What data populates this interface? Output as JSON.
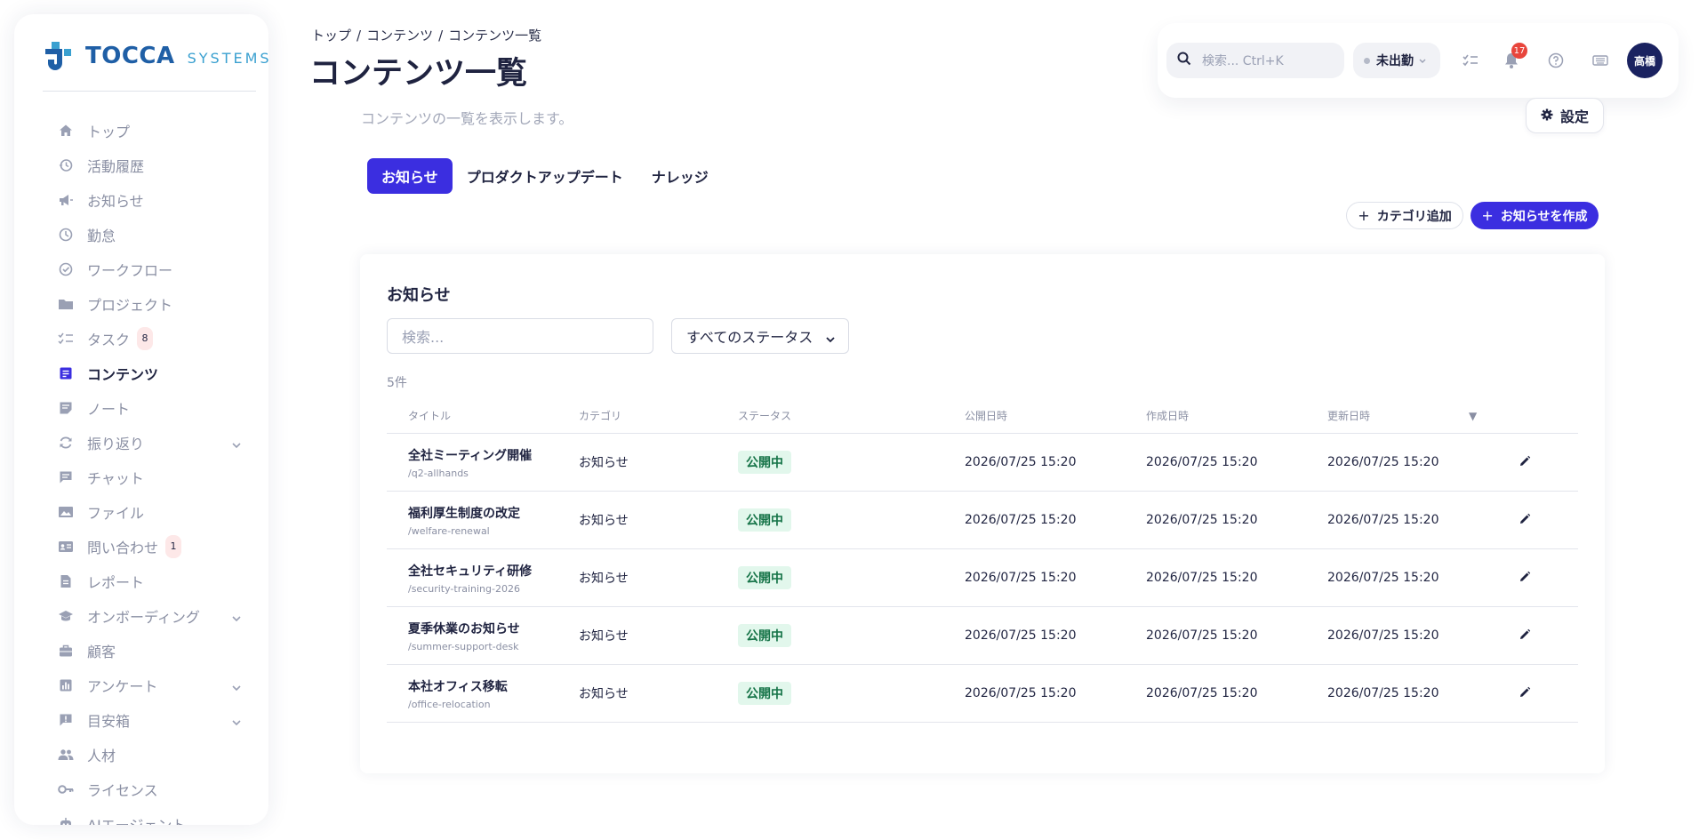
{
  "brand": {
    "name": "TOCCA",
    "sub": "SYSTEMS",
    "primary": "#3b2ee0"
  },
  "sidebar": {
    "items": [
      {
        "label": "トップ",
        "icon": "home-icon"
      },
      {
        "label": "活動履歴",
        "icon": "history-icon"
      },
      {
        "label": "お知らせ",
        "icon": "megaphone-icon"
      },
      {
        "label": "勤怠",
        "icon": "clock-icon"
      },
      {
        "label": "ワークフロー",
        "icon": "check-circle-icon"
      },
      {
        "label": "プロジェクト",
        "icon": "folder-icon"
      },
      {
        "label": "タスク",
        "icon": "checklist-icon",
        "badge": "8"
      },
      {
        "label": "コンテンツ",
        "icon": "document-icon",
        "active": true
      },
      {
        "label": "ノート",
        "icon": "note-icon"
      },
      {
        "label": "振り返り",
        "icon": "refresh-icon",
        "chevron": true
      },
      {
        "label": "チャット",
        "icon": "chat-icon"
      },
      {
        "label": "ファイル",
        "icon": "image-icon"
      },
      {
        "label": "問い合わせ",
        "icon": "id-card-icon",
        "badge": "1"
      },
      {
        "label": "レポート",
        "icon": "report-icon"
      },
      {
        "label": "オンボーディング",
        "icon": "graduation-icon",
        "chevron": true
      },
      {
        "label": "顧客",
        "icon": "briefcase-icon"
      },
      {
        "label": "アンケート",
        "icon": "bar-chart-icon",
        "chevron": true
      },
      {
        "label": "目安箱",
        "icon": "feedback-icon",
        "chevron": true
      },
      {
        "label": "人材",
        "icon": "people-icon"
      },
      {
        "label": "ライセンス",
        "icon": "key-icon"
      },
      {
        "label": "AIエージェント",
        "icon": "robot-icon"
      }
    ]
  },
  "header": {
    "breadcrumb": [
      "トップ",
      "コンテンツ",
      "コンテンツ一覧"
    ],
    "title": "コンテンツ一覧",
    "search_placeholder": "検索... Ctrl+K",
    "attendance_status": "未出勤",
    "notification_count": "17",
    "avatar": "高橋"
  },
  "main": {
    "subtitle": "コンテンツの一覧を表示します。",
    "settings_label": "設定",
    "tabs": [
      "お知らせ",
      "プロダクトアップデート",
      "ナレッジ"
    ],
    "active_tab": 0,
    "add_category_label": "カテゴリ追加",
    "create_label": "お知らせを作成",
    "card": {
      "title": "お知らせ",
      "search_placeholder": "検索...",
      "status_filter": "すべてのステータス",
      "count": "5件",
      "columns": [
        "タイトル",
        "カテゴリ",
        "ステータス",
        "公開日時",
        "作成日時",
        "更新日時",
        "▼"
      ],
      "rows": [
        {
          "title": "全社ミーティング開催",
          "slug": "/q2-allhands",
          "category": "お知らせ",
          "status": "公開中",
          "published": "2026/07/25 15:20",
          "created": "2026/07/25 15:20",
          "updated": "2026/07/25 15:20"
        },
        {
          "title": "福利厚生制度の改定",
          "slug": "/welfare-renewal",
          "category": "お知らせ",
          "status": "公開中",
          "published": "2026/07/25 15:20",
          "created": "2026/07/25 15:20",
          "updated": "2026/07/25 15:20"
        },
        {
          "title": "全社セキュリティ研修",
          "slug": "/security-training-2026",
          "category": "お知らせ",
          "status": "公開中",
          "published": "2026/07/25 15:20",
          "created": "2026/07/25 15:20",
          "updated": "2026/07/25 15:20"
        },
        {
          "title": "夏季休業のお知らせ",
          "slug": "/summer-support-desk",
          "category": "お知らせ",
          "status": "公開中",
          "published": "2026/07/25 15:20",
          "created": "2026/07/25 15:20",
          "updated": "2026/07/25 15:20"
        },
        {
          "title": "本社オフィス移転",
          "slug": "/office-relocation",
          "category": "お知らせ",
          "status": "公開中",
          "published": "2026/07/25 15:20",
          "created": "2026/07/25 15:20",
          "updated": "2026/07/25 15:20"
        }
      ]
    }
  }
}
